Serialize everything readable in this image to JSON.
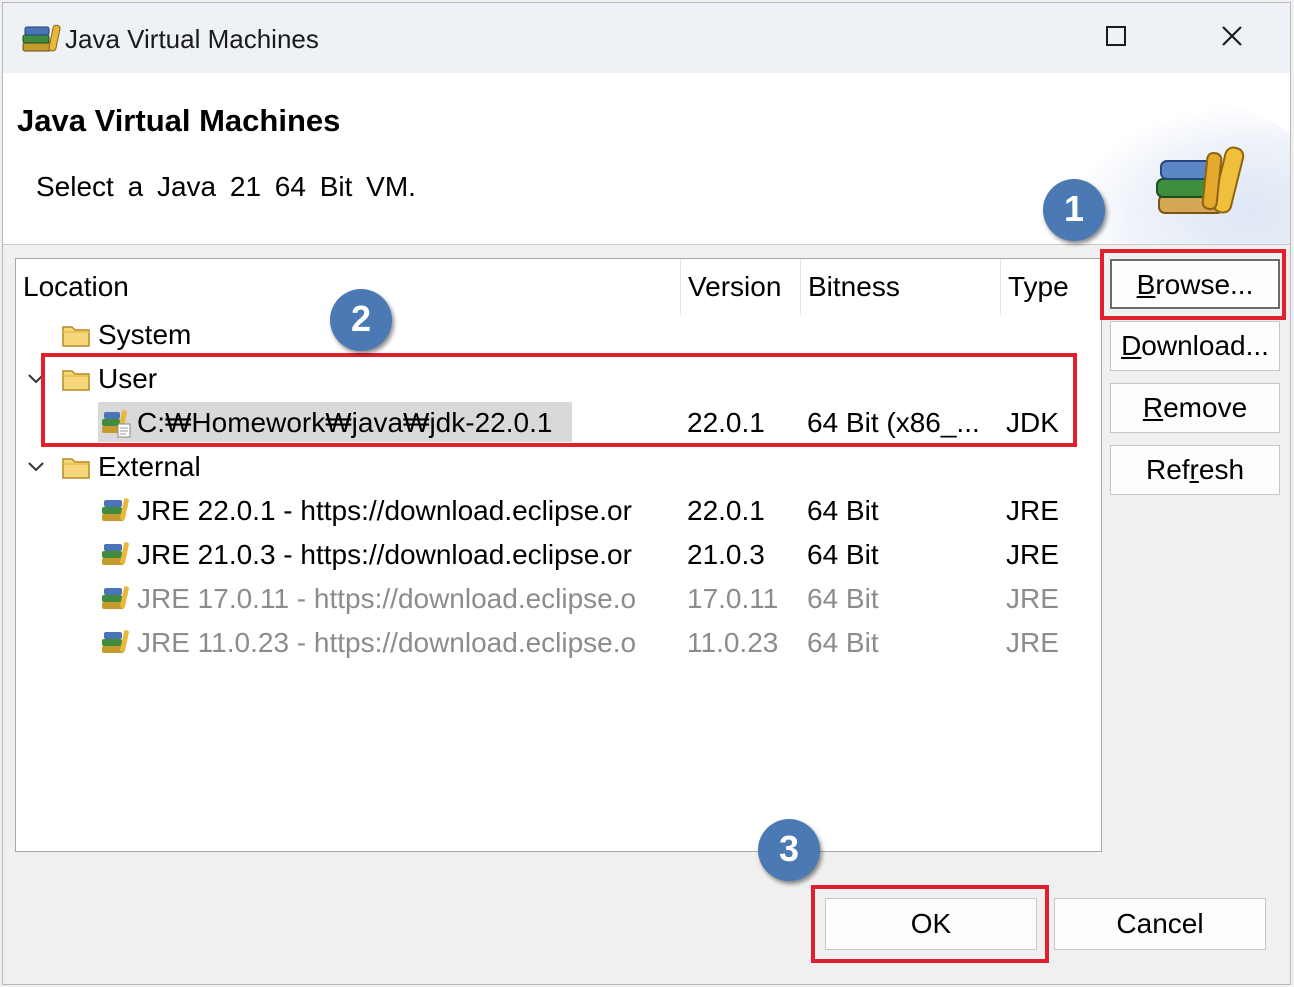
{
  "window": {
    "title": "Java Virtual Machines",
    "controls": {
      "maximize_icon": "maximize-icon",
      "close_icon": "close-icon"
    }
  },
  "header": {
    "heading": "Java Virtual Machines",
    "description": "Select a Java 21 64 Bit VM."
  },
  "table": {
    "columns": [
      "Location",
      "Version",
      "Bitness",
      "Type"
    ],
    "groups": [
      {
        "label": "System",
        "expanded": false,
        "items": []
      },
      {
        "label": "User",
        "expanded": true,
        "items": [
          {
            "location": "C:₩Homework₩java₩jdk-22.0.1",
            "version": "22.0.1",
            "bitness": "64 Bit (x86_...",
            "type": "JDK",
            "selected": true,
            "dimmed": false
          }
        ]
      },
      {
        "label": "External",
        "expanded": true,
        "items": [
          {
            "location": "JRE 22.0.1 - https://download.eclipse.or",
            "version": "22.0.1",
            "bitness": "64 Bit",
            "type": "JRE",
            "dimmed": false
          },
          {
            "location": "JRE 21.0.3 - https://download.eclipse.or",
            "version": "21.0.3",
            "bitness": "64 Bit",
            "type": "JRE",
            "dimmed": false
          },
          {
            "location": "JRE 17.0.11 - https://download.eclipse.o",
            "version": "17.0.11",
            "bitness": "64 Bit",
            "type": "JRE",
            "dimmed": true
          },
          {
            "location": "JRE 11.0.23 - https://download.eclipse.o",
            "version": "11.0.23",
            "bitness": "64 Bit",
            "type": "JRE",
            "dimmed": true
          }
        ]
      }
    ]
  },
  "side_buttons": {
    "browse": {
      "mnemonic": "B",
      "rest": "rowse..."
    },
    "download": {
      "mnemonic": "D",
      "rest": "ownload..."
    },
    "remove": {
      "mnemonic": "R",
      "rest": "emove"
    },
    "refresh": {
      "pre": "Ref",
      "mnemonic": "r",
      "rest": "esh"
    }
  },
  "footer": {
    "ok_label": "OK",
    "cancel_label": "Cancel"
  },
  "annotations": {
    "step1": "1",
    "step2": "2",
    "step3": "3",
    "highlight_color": "#e0202e",
    "badge_color": "#4a79b4"
  },
  "icons": {
    "folder": "folder-icon",
    "vm": "java-vm-icon",
    "twisty": "chevron-down-icon"
  }
}
